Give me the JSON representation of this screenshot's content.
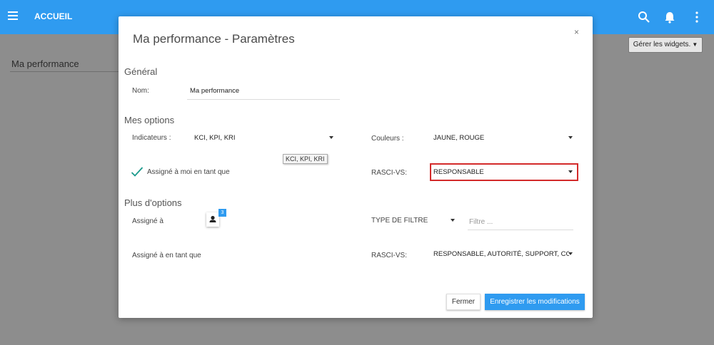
{
  "appbar": {
    "title": "ACCUEIL",
    "icons": [
      "menu-icon",
      "search-icon",
      "bell-icon",
      "more-vert-icon"
    ]
  },
  "background": {
    "page_title": "Ma performance",
    "widgets_button": "Gérer les widgets."
  },
  "modal": {
    "title": "Ma performance - Paramètres",
    "close": "×",
    "general": {
      "section": "Général",
      "name_label": "Nom:",
      "name_value": "Ma performance"
    },
    "my_options": {
      "section": "Mes options",
      "indicators_label": "Indicateurs :",
      "indicators_value": "KCI, KPI, KRI",
      "indicators_tooltip": "KCI, KPI, KRI",
      "colors_label": "Couleurs :",
      "colors_value": "JAUNE, ROUGE",
      "assigned_me_label": "Assigné à moi en tant que",
      "rasci_label": "RASCI-VS:",
      "rasci_value": "RESPONSABLE"
    },
    "more_options": {
      "section": "Plus d'options",
      "assigned_label": "Assigné à",
      "avatar_badge": "3",
      "filter_type_label": "TYPE DE FILTRE",
      "filter_placeholder": "Filtre ...",
      "assigned_as_label": "Assigné à en tant que",
      "rasci_label": "RASCI-VS:",
      "rasci_value": "RESPONSABLE, AUTORITÉ, SUPPORT, CONS"
    },
    "buttons": {
      "close": "Fermer",
      "save": "Enregistrer les modifications"
    }
  },
  "colors": {
    "accent": "#2f9bf0",
    "highlight": "#d32a2a",
    "check": "#1a9a8c"
  }
}
